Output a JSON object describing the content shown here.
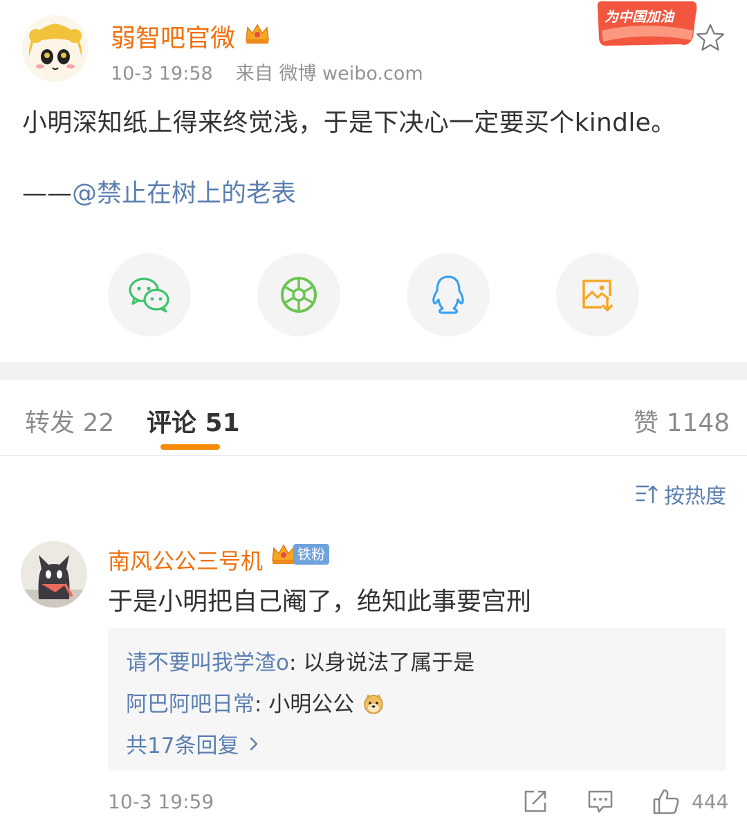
{
  "post": {
    "username": "弱智吧官微",
    "time": "10-3 19:58",
    "source": "来自 微博 weibo.com",
    "badge_text": "为中国加油",
    "text": "小明深知纸上得来终觉浅，于是下决心一定要买个kindle。",
    "credit_dash": "——",
    "credit_user": "@禁止在树上的老表"
  },
  "share": [
    "wechat-icon",
    "moments-icon",
    "qq-icon",
    "save-image-icon"
  ],
  "tabs": {
    "repost": "转发 22",
    "comments": "评论 51",
    "likes": "赞 1148"
  },
  "sort_label": "按热度",
  "comment": {
    "username": "南风公公三号机",
    "fan_badge": "铁粉",
    "text": "于是小明把自己阉了，绝知此事要宫刑",
    "replies": [
      {
        "user": "请不要叫我学渣o",
        "sep": ": ",
        "text": "以身说法了属于是"
      },
      {
        "user": "阿巴阿吧日常",
        "sep": ": ",
        "text": "小明公公"
      }
    ],
    "more_replies": "共17条回复",
    "time": "10-3 19:59",
    "like_count": "444"
  },
  "colors": {
    "username": "#f0700e",
    "link": "#5b7fb0",
    "accent": "#f78a08"
  }
}
